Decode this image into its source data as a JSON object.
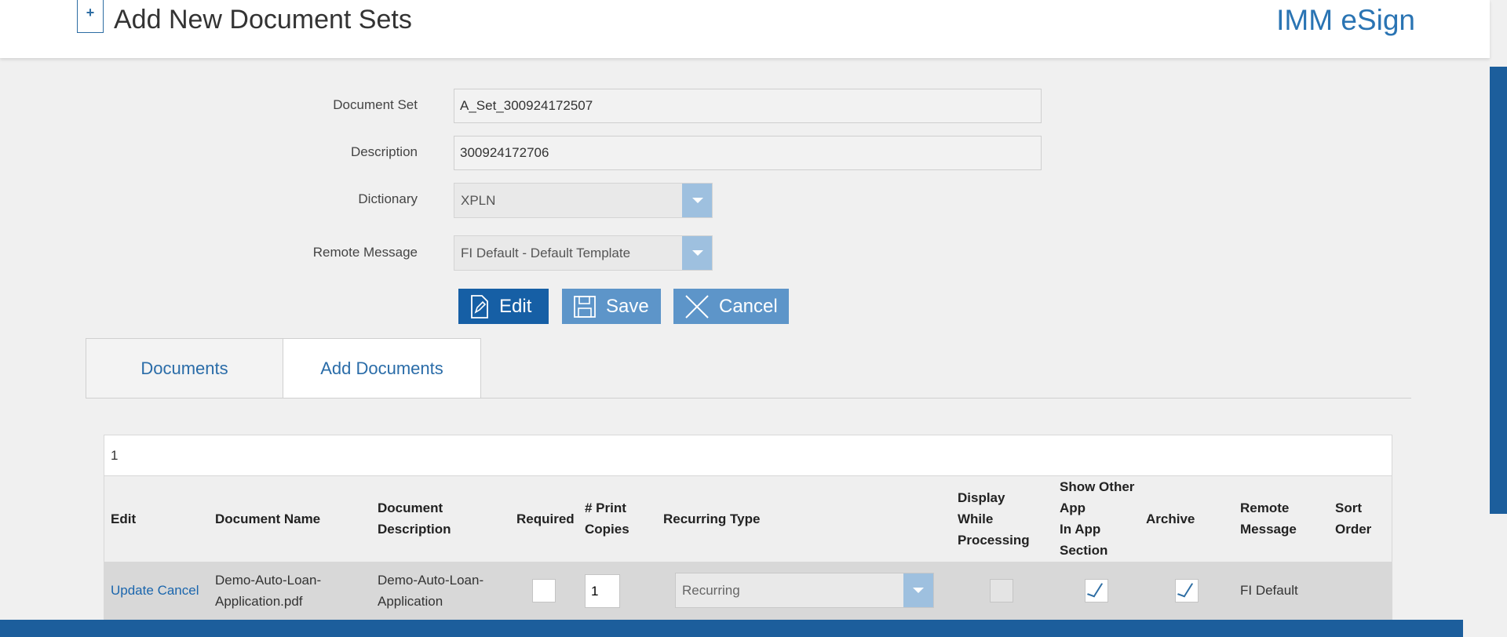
{
  "header": {
    "title": "Add New Document Sets",
    "brand": "IMM eSign",
    "new_icon_glyph": "+"
  },
  "form": {
    "document_set": {
      "label": "Document Set",
      "value": "A_Set_300924172507"
    },
    "description": {
      "label": "Description",
      "value": "300924172706"
    },
    "dictionary": {
      "label": "Dictionary",
      "value": "XPLN"
    },
    "remote_message": {
      "label": "Remote Message",
      "value": "FI Default - Default Template"
    }
  },
  "actions": {
    "edit": "Edit",
    "save": "Save",
    "cancel": "Cancel"
  },
  "tabs": [
    {
      "label": "Documents"
    },
    {
      "label": "Add Documents",
      "active": true
    }
  ],
  "grid": {
    "page": "1",
    "columns": {
      "edit": "Edit",
      "document_name": "Document Name",
      "document_description": "Document\nDescription",
      "required": "Required",
      "print_copies": "# Print\nCopies",
      "recurring_type": "Recurring Type",
      "display_while_processing": "Display\nWhile\nProcessing",
      "show_other_app": "Show Other\nApp\nIn App\nSection",
      "archive": "Archive",
      "remote_message": "Remote\nMessage",
      "sort_order": "Sort\nOrder"
    },
    "rows": [
      {
        "update": "Update",
        "cancel": "Cancel",
        "document_name": "Demo-Auto-Loan-\nApplication.pdf",
        "document_description": "Demo-Auto-Loan-\nApplication",
        "required": false,
        "print_copies": "1",
        "recurring_type": "Recurring",
        "display_while_processing": false,
        "show_other_app": true,
        "archive": true,
        "remote_message": "FI Default",
        "sort_order": ""
      }
    ]
  },
  "colors": {
    "accent": "#165fa5",
    "secondary": "#5d95c9",
    "link": "#1b66ad",
    "bar": "#1c5e9c"
  }
}
